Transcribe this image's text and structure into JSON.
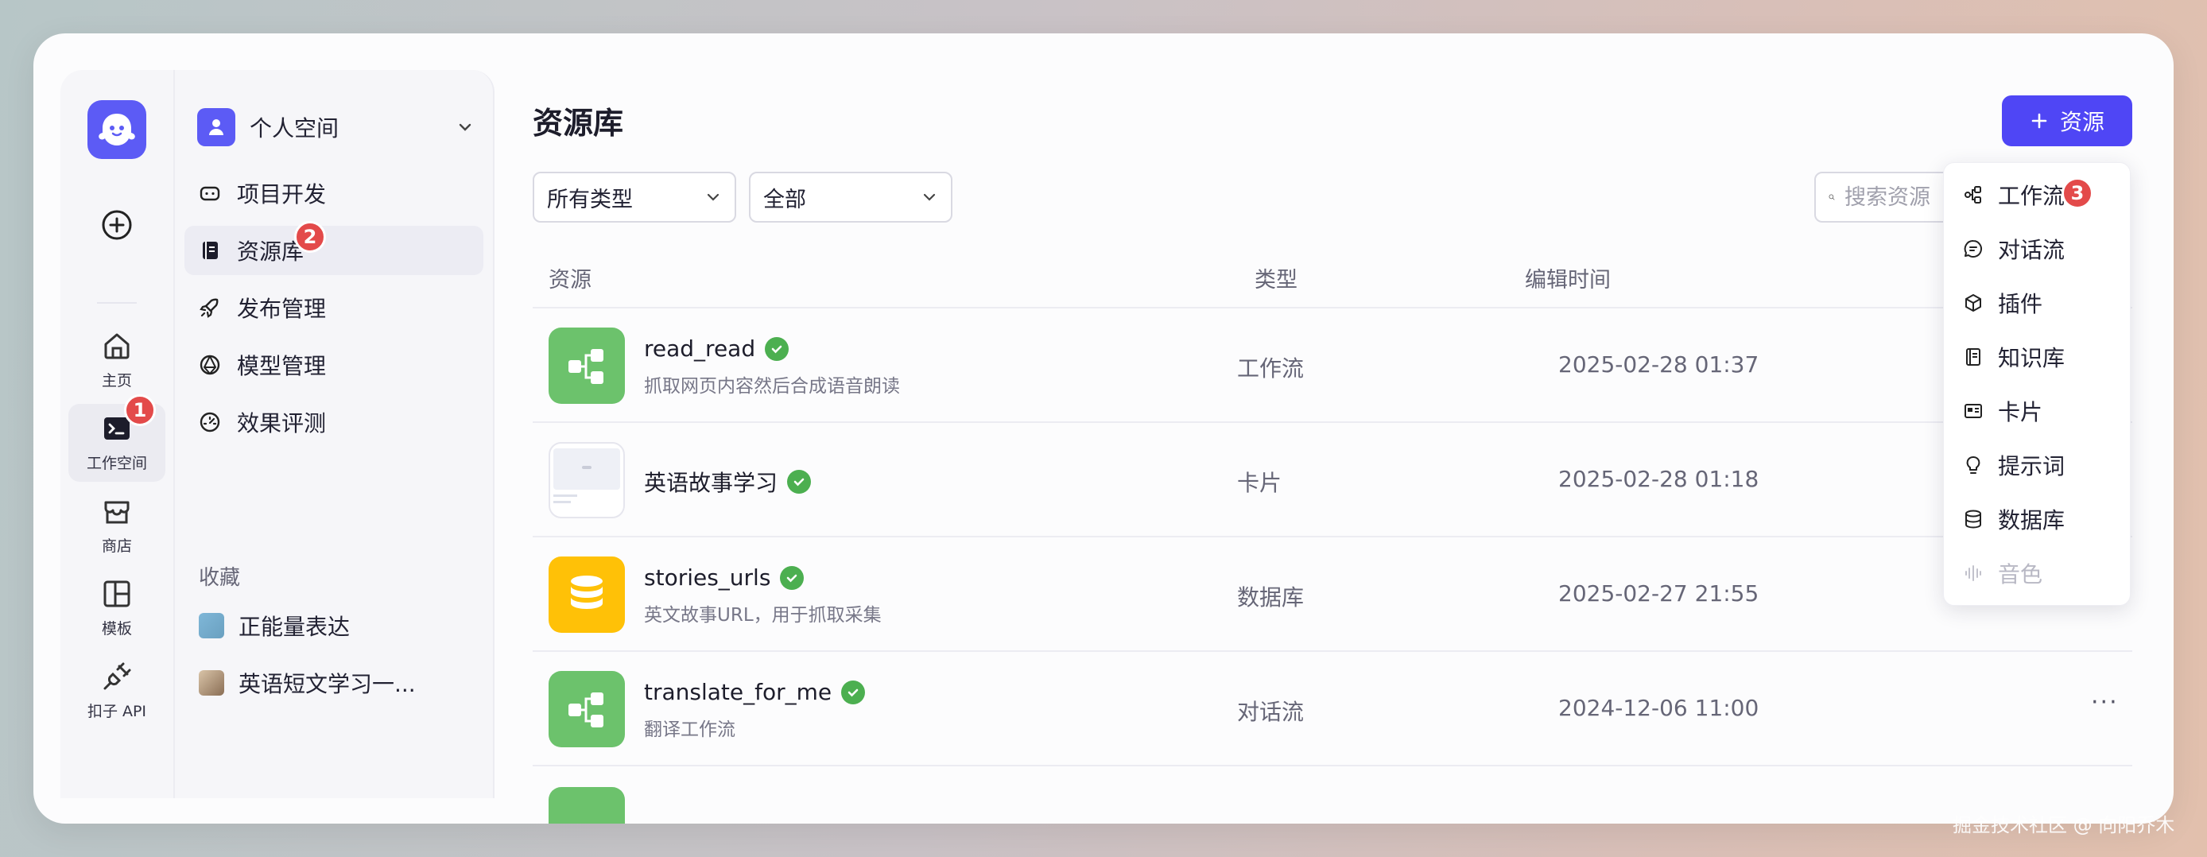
{
  "rail": {
    "items": [
      {
        "label": "主页"
      },
      {
        "label": "工作空间"
      },
      {
        "label": "商店"
      },
      {
        "label": "模板"
      },
      {
        "label": "扣子 API"
      }
    ],
    "badge": "1"
  },
  "sidebar": {
    "workspace_name": "个人空间",
    "items": [
      {
        "label": "项目开发",
        "icon": "gamepad-icon"
      },
      {
        "label": "资源库",
        "icon": "library-icon"
      },
      {
        "label": "发布管理",
        "icon": "rocket-icon"
      },
      {
        "label": "模型管理",
        "icon": "cube-icon"
      },
      {
        "label": "效果评测",
        "icon": "gauge-icon"
      }
    ],
    "badge": "2",
    "favorites_title": "收藏",
    "favorites": [
      {
        "label": "正能量表达"
      },
      {
        "label": "英语短文学习一..."
      }
    ]
  },
  "main": {
    "title": "资源库",
    "add_button": "资源",
    "filter_type": "所有类型",
    "filter_scope": "全部",
    "search_placeholder": "搜索资源",
    "columns": [
      "资源",
      "类型",
      "编辑时间"
    ],
    "rows": [
      {
        "name": "read_read",
        "desc": "抓取网页内容然后合成语音朗读",
        "type": "工作流",
        "time": "2025-02-28 01:37"
      },
      {
        "name": "英语故事学习",
        "desc": "",
        "type": "卡片",
        "time": "2025-02-28 01:18"
      },
      {
        "name": "stories_urls",
        "desc": "英文故事URL，用于抓取采集",
        "type": "数据库",
        "time": "2025-02-27 21:55"
      },
      {
        "name": "translate_for_me",
        "desc": "翻译工作流",
        "type": "对话流",
        "time": "2024-12-06 11:00"
      }
    ],
    "more_label": "···"
  },
  "dropdown": {
    "items": [
      {
        "label": "工作流"
      },
      {
        "label": "对话流"
      },
      {
        "label": "插件"
      },
      {
        "label": "知识库"
      },
      {
        "label": "卡片"
      },
      {
        "label": "提示词"
      },
      {
        "label": "数据库"
      },
      {
        "label": "音色"
      }
    ],
    "badge": "3"
  },
  "watermark": "掘金技术社区 @ 向阳乔木",
  "colors": {
    "accent": "#4f46f5",
    "green": "#6cc26c",
    "yellow": "#ffc107",
    "badge": "#e34a4a"
  }
}
